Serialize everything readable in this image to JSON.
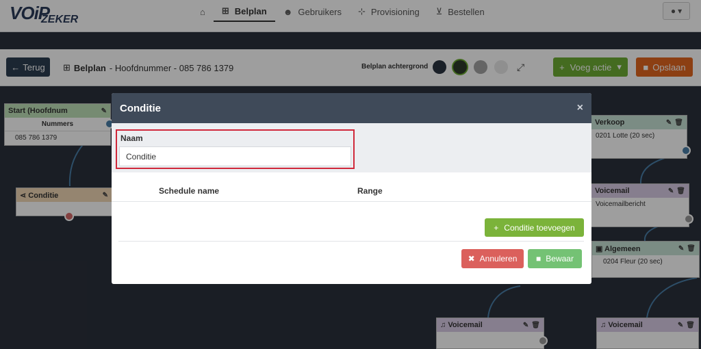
{
  "brand": {
    "logo_main": "VOiP",
    "logo_sub": "ZEKER"
  },
  "nav": {
    "items": [
      {
        "label": "",
        "icon": "home-icon"
      },
      {
        "label": "Belplan",
        "icon": "sitemap-icon"
      },
      {
        "label": "Gebruikers",
        "icon": "users-icon"
      },
      {
        "label": "Provisioning",
        "icon": "network-icon"
      },
      {
        "label": "Bestellen",
        "icon": "cart-icon"
      }
    ],
    "user_icon": "user-icon"
  },
  "toolbar": {
    "back_label": "Terug",
    "crumb_bold": "Belplan",
    "crumb_rest": " - Hoofdnummer - 085 786 1379",
    "bg_label": "Belplan achtergrond",
    "swatches": [
      "#2b3542",
      "#2e3b2a",
      "#a3a3a3",
      "#e7e7e7"
    ],
    "add_label": "Voeg actie",
    "save_label": "Opslaan"
  },
  "canvas": {
    "start": {
      "title": "Start (Hoofdnum",
      "col": "Nummers",
      "value": "085 786 1379"
    },
    "condition": {
      "title": "Conditie"
    },
    "verkoop": {
      "title": "Verkoop",
      "value": "0201 Lotte (20 sec)"
    },
    "voicemail1": {
      "title": "Voicemail",
      "value": "Voicemailbericht"
    },
    "algemeen": {
      "title": "Algemeen",
      "value": "0204 Fleur (20 sec)"
    },
    "voicemail2": {
      "title": "Voicemail"
    },
    "voicemail3": {
      "title": "Voicemail"
    }
  },
  "modal": {
    "title": "Conditie",
    "close": "×",
    "name_label": "Naam",
    "name_value": "Conditie",
    "col_schedule": "Schedule name",
    "col_range": "Range",
    "add_label": "Conditie toevoegen",
    "cancel_label": "Annuleren",
    "keep_label": "Bewaar"
  },
  "colors": {
    "start_head": "#bfe0b8",
    "condition_head": "#f0d7b5",
    "verkoop_head": "#c7e3d6",
    "voicemail_head": "#d9cbe6",
    "highlight": "#d0283a"
  }
}
